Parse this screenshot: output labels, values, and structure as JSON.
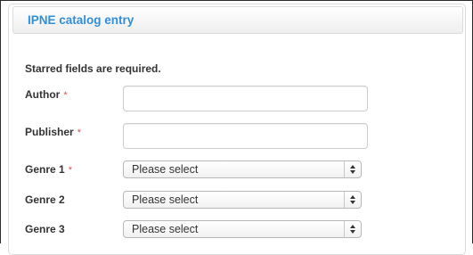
{
  "panel": {
    "title": "IPNE catalog entry"
  },
  "form": {
    "required_note": "Starred fields are required.",
    "required_marker": "*",
    "fields": [
      {
        "label": "Author",
        "required": true,
        "type": "text",
        "value": ""
      },
      {
        "label": "Publisher",
        "required": true,
        "type": "text",
        "value": ""
      },
      {
        "label": "Genre 1",
        "required": true,
        "type": "select",
        "value": "Please select"
      },
      {
        "label": "Genre 2",
        "required": false,
        "type": "select",
        "value": "Please select"
      },
      {
        "label": "Genre 3",
        "required": false,
        "type": "select",
        "value": "Please select"
      }
    ]
  },
  "colors": {
    "title": "#2f8fd8",
    "required_star": "#d9534f",
    "label_text": "#333333"
  }
}
